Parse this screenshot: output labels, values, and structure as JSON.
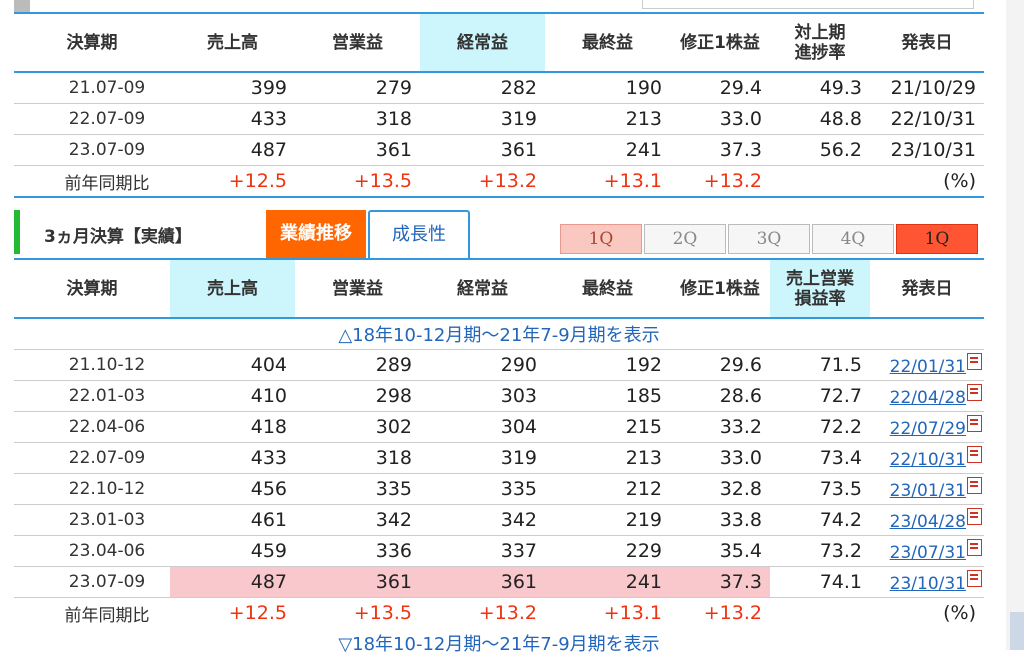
{
  "columns": {
    "period": "決算期",
    "sales": "売上高",
    "op": "営業益",
    "ordinary": "経常益",
    "net": "最終益",
    "eps": "修正1株益",
    "progress_1": "対上期",
    "progress_2": "進捗率",
    "margin_1": "売上営業",
    "margin_2": "損益率",
    "date": "発表日"
  },
  "annual": {
    "rows": [
      {
        "period": "21.07-09",
        "sales": "399",
        "op": "279",
        "ordinary": "282",
        "net": "190",
        "eps": "29.4",
        "ratio": "49.3",
        "date": "21/10/29"
      },
      {
        "period": "22.07-09",
        "sales": "433",
        "op": "318",
        "ordinary": "319",
        "net": "213",
        "eps": "33.0",
        "ratio": "48.8",
        "date": "22/10/31"
      },
      {
        "period": "23.07-09",
        "sales": "487",
        "op": "361",
        "ordinary": "361",
        "net": "241",
        "eps": "37.3",
        "ratio": "56.2",
        "date": "23/10/31"
      }
    ],
    "yoy": {
      "label": "前年同期比",
      "sales": "+12.5",
      "op": "+13.5",
      "ordinary": "+13.2",
      "net": "+13.1",
      "eps": "+13.2",
      "unit": "(%)"
    }
  },
  "section": {
    "title": "3ヵ月決算【実績】",
    "tab_active": "業績推移",
    "tab_other": "成長性",
    "quarters": [
      "1Q",
      "2Q",
      "3Q",
      "4Q",
      "1Q"
    ]
  },
  "quarter": {
    "toggle_top": "△18年10-12月期～21年7-9月期を表示",
    "toggle_bottom": "▽18年10-12月期～21年7-9月期を表示",
    "rows": [
      {
        "period": "21.10-12",
        "sales": "404",
        "op": "289",
        "ordinary": "290",
        "net": "192",
        "eps": "29.6",
        "ratio": "71.5",
        "date": "22/01/31"
      },
      {
        "period": "22.01-03",
        "sales": "410",
        "op": "298",
        "ordinary": "303",
        "net": "185",
        "eps": "28.6",
        "ratio": "72.7",
        "date": "22/04/28"
      },
      {
        "period": "22.04-06",
        "sales": "418",
        "op": "302",
        "ordinary": "304",
        "net": "215",
        "eps": "33.2",
        "ratio": "72.2",
        "date": "22/07/29"
      },
      {
        "period": "22.07-09",
        "sales": "433",
        "op": "318",
        "ordinary": "319",
        "net": "213",
        "eps": "33.0",
        "ratio": "73.4",
        "date": "22/10/31"
      },
      {
        "period": "22.10-12",
        "sales": "456",
        "op": "335",
        "ordinary": "335",
        "net": "212",
        "eps": "32.8",
        "ratio": "73.5",
        "date": "23/01/31"
      },
      {
        "period": "23.01-03",
        "sales": "461",
        "op": "342",
        "ordinary": "342",
        "net": "219",
        "eps": "33.8",
        "ratio": "74.2",
        "date": "23/04/28"
      },
      {
        "period": "23.04-06",
        "sales": "459",
        "op": "336",
        "ordinary": "337",
        "net": "229",
        "eps": "35.4",
        "ratio": "73.2",
        "date": "23/07/31"
      },
      {
        "period": "23.07-09",
        "sales": "487",
        "op": "361",
        "ordinary": "361",
        "net": "241",
        "eps": "37.3",
        "ratio": "74.1",
        "date": "23/10/31"
      }
    ],
    "yoy": {
      "label": "前年同期比",
      "sales": "+12.5",
      "op": "+13.5",
      "ordinary": "+13.2",
      "net": "+13.1",
      "eps": "+13.2",
      "unit": "(%)"
    }
  },
  "colors": {
    "accent_orange": "#ff6600",
    "link_blue": "#2266bb",
    "up_red": "#ee3311",
    "highlight_pink": "#f8c8cc",
    "header_cyan": "#ccf6fb"
  },
  "icons": {
    "pdf": "pdf-icon"
  }
}
